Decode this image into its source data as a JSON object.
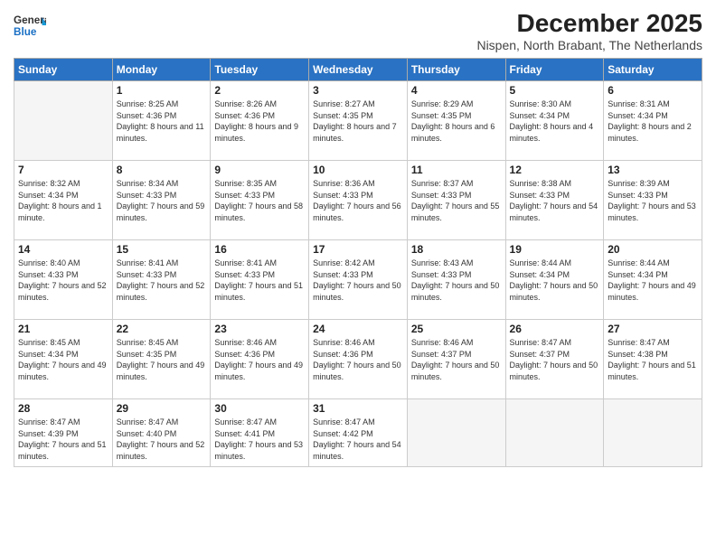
{
  "logo": {
    "general": "General",
    "blue": "Blue"
  },
  "title": "December 2025",
  "location": "Nispen, North Brabant, The Netherlands",
  "days_of_week": [
    "Sunday",
    "Monday",
    "Tuesday",
    "Wednesday",
    "Thursday",
    "Friday",
    "Saturday"
  ],
  "weeks": [
    [
      {
        "day": "",
        "sunrise": "",
        "sunset": "",
        "daylight": "",
        "empty": true
      },
      {
        "day": "1",
        "sunrise": "Sunrise: 8:25 AM",
        "sunset": "Sunset: 4:36 PM",
        "daylight": "Daylight: 8 hours and 11 minutes."
      },
      {
        "day": "2",
        "sunrise": "Sunrise: 8:26 AM",
        "sunset": "Sunset: 4:36 PM",
        "daylight": "Daylight: 8 hours and 9 minutes."
      },
      {
        "day": "3",
        "sunrise": "Sunrise: 8:27 AM",
        "sunset": "Sunset: 4:35 PM",
        "daylight": "Daylight: 8 hours and 7 minutes."
      },
      {
        "day": "4",
        "sunrise": "Sunrise: 8:29 AM",
        "sunset": "Sunset: 4:35 PM",
        "daylight": "Daylight: 8 hours and 6 minutes."
      },
      {
        "day": "5",
        "sunrise": "Sunrise: 8:30 AM",
        "sunset": "Sunset: 4:34 PM",
        "daylight": "Daylight: 8 hours and 4 minutes."
      },
      {
        "day": "6",
        "sunrise": "Sunrise: 8:31 AM",
        "sunset": "Sunset: 4:34 PM",
        "daylight": "Daylight: 8 hours and 2 minutes."
      }
    ],
    [
      {
        "day": "7",
        "sunrise": "Sunrise: 8:32 AM",
        "sunset": "Sunset: 4:34 PM",
        "daylight": "Daylight: 8 hours and 1 minute."
      },
      {
        "day": "8",
        "sunrise": "Sunrise: 8:34 AM",
        "sunset": "Sunset: 4:33 PM",
        "daylight": "Daylight: 7 hours and 59 minutes."
      },
      {
        "day": "9",
        "sunrise": "Sunrise: 8:35 AM",
        "sunset": "Sunset: 4:33 PM",
        "daylight": "Daylight: 7 hours and 58 minutes."
      },
      {
        "day": "10",
        "sunrise": "Sunrise: 8:36 AM",
        "sunset": "Sunset: 4:33 PM",
        "daylight": "Daylight: 7 hours and 56 minutes."
      },
      {
        "day": "11",
        "sunrise": "Sunrise: 8:37 AM",
        "sunset": "Sunset: 4:33 PM",
        "daylight": "Daylight: 7 hours and 55 minutes."
      },
      {
        "day": "12",
        "sunrise": "Sunrise: 8:38 AM",
        "sunset": "Sunset: 4:33 PM",
        "daylight": "Daylight: 7 hours and 54 minutes."
      },
      {
        "day": "13",
        "sunrise": "Sunrise: 8:39 AM",
        "sunset": "Sunset: 4:33 PM",
        "daylight": "Daylight: 7 hours and 53 minutes."
      }
    ],
    [
      {
        "day": "14",
        "sunrise": "Sunrise: 8:40 AM",
        "sunset": "Sunset: 4:33 PM",
        "daylight": "Daylight: 7 hours and 52 minutes."
      },
      {
        "day": "15",
        "sunrise": "Sunrise: 8:41 AM",
        "sunset": "Sunset: 4:33 PM",
        "daylight": "Daylight: 7 hours and 52 minutes."
      },
      {
        "day": "16",
        "sunrise": "Sunrise: 8:41 AM",
        "sunset": "Sunset: 4:33 PM",
        "daylight": "Daylight: 7 hours and 51 minutes."
      },
      {
        "day": "17",
        "sunrise": "Sunrise: 8:42 AM",
        "sunset": "Sunset: 4:33 PM",
        "daylight": "Daylight: 7 hours and 50 minutes."
      },
      {
        "day": "18",
        "sunrise": "Sunrise: 8:43 AM",
        "sunset": "Sunset: 4:33 PM",
        "daylight": "Daylight: 7 hours and 50 minutes."
      },
      {
        "day": "19",
        "sunrise": "Sunrise: 8:44 AM",
        "sunset": "Sunset: 4:34 PM",
        "daylight": "Daylight: 7 hours and 50 minutes."
      },
      {
        "day": "20",
        "sunrise": "Sunrise: 8:44 AM",
        "sunset": "Sunset: 4:34 PM",
        "daylight": "Daylight: 7 hours and 49 minutes."
      }
    ],
    [
      {
        "day": "21",
        "sunrise": "Sunrise: 8:45 AM",
        "sunset": "Sunset: 4:34 PM",
        "daylight": "Daylight: 7 hours and 49 minutes."
      },
      {
        "day": "22",
        "sunrise": "Sunrise: 8:45 AM",
        "sunset": "Sunset: 4:35 PM",
        "daylight": "Daylight: 7 hours and 49 minutes."
      },
      {
        "day": "23",
        "sunrise": "Sunrise: 8:46 AM",
        "sunset": "Sunset: 4:36 PM",
        "daylight": "Daylight: 7 hours and 49 minutes."
      },
      {
        "day": "24",
        "sunrise": "Sunrise: 8:46 AM",
        "sunset": "Sunset: 4:36 PM",
        "daylight": "Daylight: 7 hours and 50 minutes."
      },
      {
        "day": "25",
        "sunrise": "Sunrise: 8:46 AM",
        "sunset": "Sunset: 4:37 PM",
        "daylight": "Daylight: 7 hours and 50 minutes."
      },
      {
        "day": "26",
        "sunrise": "Sunrise: 8:47 AM",
        "sunset": "Sunset: 4:37 PM",
        "daylight": "Daylight: 7 hours and 50 minutes."
      },
      {
        "day": "27",
        "sunrise": "Sunrise: 8:47 AM",
        "sunset": "Sunset: 4:38 PM",
        "daylight": "Daylight: 7 hours and 51 minutes."
      }
    ],
    [
      {
        "day": "28",
        "sunrise": "Sunrise: 8:47 AM",
        "sunset": "Sunset: 4:39 PM",
        "daylight": "Daylight: 7 hours and 51 minutes."
      },
      {
        "day": "29",
        "sunrise": "Sunrise: 8:47 AM",
        "sunset": "Sunset: 4:40 PM",
        "daylight": "Daylight: 7 hours and 52 minutes."
      },
      {
        "day": "30",
        "sunrise": "Sunrise: 8:47 AM",
        "sunset": "Sunset: 4:41 PM",
        "daylight": "Daylight: 7 hours and 53 minutes."
      },
      {
        "day": "31",
        "sunrise": "Sunrise: 8:47 AM",
        "sunset": "Sunset: 4:42 PM",
        "daylight": "Daylight: 7 hours and 54 minutes."
      },
      {
        "day": "",
        "sunrise": "",
        "sunset": "",
        "daylight": "",
        "empty": true
      },
      {
        "day": "",
        "sunrise": "",
        "sunset": "",
        "daylight": "",
        "empty": true
      },
      {
        "day": "",
        "sunrise": "",
        "sunset": "",
        "daylight": "",
        "empty": true
      }
    ]
  ]
}
